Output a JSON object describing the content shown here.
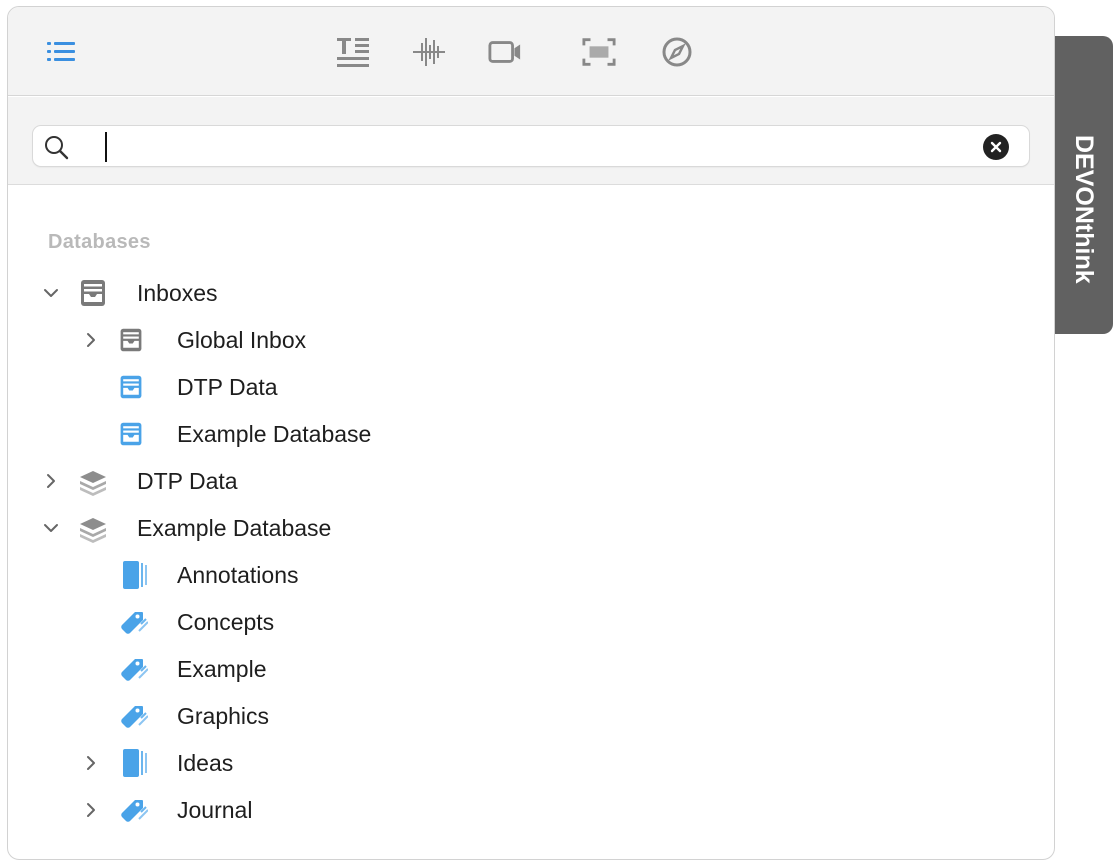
{
  "toolbar": {
    "buttons": [
      {
        "name": "list-view-button",
        "icon": "list-icon",
        "color": "#3a8fe0"
      },
      {
        "name": "text-button",
        "icon": "text-format-icon",
        "color": "#8a8a8a"
      },
      {
        "name": "audio-button",
        "icon": "waveform-icon",
        "color": "#8a8a8a"
      },
      {
        "name": "video-button",
        "icon": "video-camera-icon",
        "color": "#8a8a8a"
      },
      {
        "name": "capture-button",
        "icon": "screen-capture-icon",
        "color": "#8a8a8a"
      },
      {
        "name": "web-button",
        "icon": "compass-icon",
        "color": "#8a8a8a"
      }
    ]
  },
  "search": {
    "value": "",
    "placeholder": ""
  },
  "sidebar": {
    "section_title": "Databases",
    "items": [
      {
        "label": "Inboxes",
        "level": 0,
        "expanded": true,
        "icon": "inbox-tray-icon"
      },
      {
        "label": "Global Inbox",
        "level": 1,
        "expanded": false,
        "icon": "inbox-tray-icon"
      },
      {
        "label": "DTP Data",
        "level": 1,
        "icon": "inbox-tray-blue-icon"
      },
      {
        "label": "Example Database",
        "level": 1,
        "icon": "inbox-tray-blue-icon"
      },
      {
        "label": "DTP Data",
        "level": 0,
        "expanded": false,
        "icon": "database-stack-icon"
      },
      {
        "label": "Example Database",
        "level": 0,
        "expanded": true,
        "icon": "database-stack-icon"
      },
      {
        "label": "Annotations",
        "level": 1,
        "icon": "group-folder-icon"
      },
      {
        "label": "Concepts",
        "level": 1,
        "icon": "tag-icon"
      },
      {
        "label": "Example",
        "level": 1,
        "icon": "tag-icon"
      },
      {
        "label": "Graphics",
        "level": 1,
        "icon": "tag-icon"
      },
      {
        "label": "Ideas",
        "level": 1,
        "expanded": false,
        "icon": "group-folder-icon"
      },
      {
        "label": "Journal",
        "level": 1,
        "expanded": false,
        "icon": "tag-icon"
      }
    ]
  },
  "side_tab": {
    "label": "DEVONthink"
  },
  "colors": {
    "accent_blue": "#4aa3e8",
    "icon_gray": "#7a7a7a"
  }
}
